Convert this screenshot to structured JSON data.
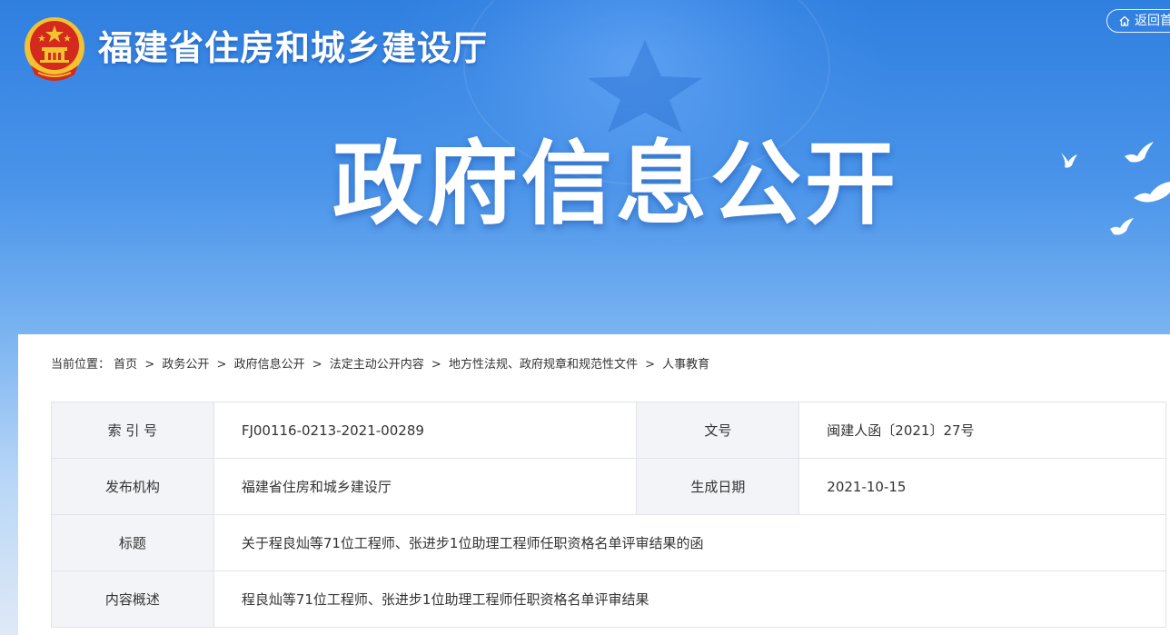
{
  "header": {
    "site_title": "福建省住房和城乡建设厅",
    "home_link": "返回首",
    "headline": "政府信息公开",
    "emblem_icon": "national-emblem-icon",
    "home_icon": "home-icon"
  },
  "breadcrumb": {
    "prefix": "当前位置：",
    "items": [
      "首页",
      "政务公开",
      "政府信息公开",
      "法定主动公开内容",
      "地方性法规、政府规章和规范性文件",
      "人事教育"
    ],
    "separator": ">"
  },
  "info": {
    "index_label": "索 引 号",
    "index_value": "FJ00116-0213-2021-00289",
    "doc_no_label": "文号",
    "doc_no_value": "闽建人函〔2021〕27号",
    "publisher_label": "发布机构",
    "publisher_value": "福建省住房和城乡建设厅",
    "date_label": "生成日期",
    "date_value": "2021-10-15",
    "title_label": "标题",
    "title_value": "关于程良灿等71位工程师、张进步1位助理工程师任职资格名单评审结果的函",
    "summary_label": "内容概述",
    "summary_value": "程良灿等71位工程师、张进步1位助理工程师任职资格名单评审结果"
  },
  "colors": {
    "banner_blue": "#2f7fe0",
    "emblem_red": "#d42a1e",
    "emblem_gold": "#f2c230",
    "label_bg": "#f3f4f8",
    "border": "#e2e4ea"
  }
}
